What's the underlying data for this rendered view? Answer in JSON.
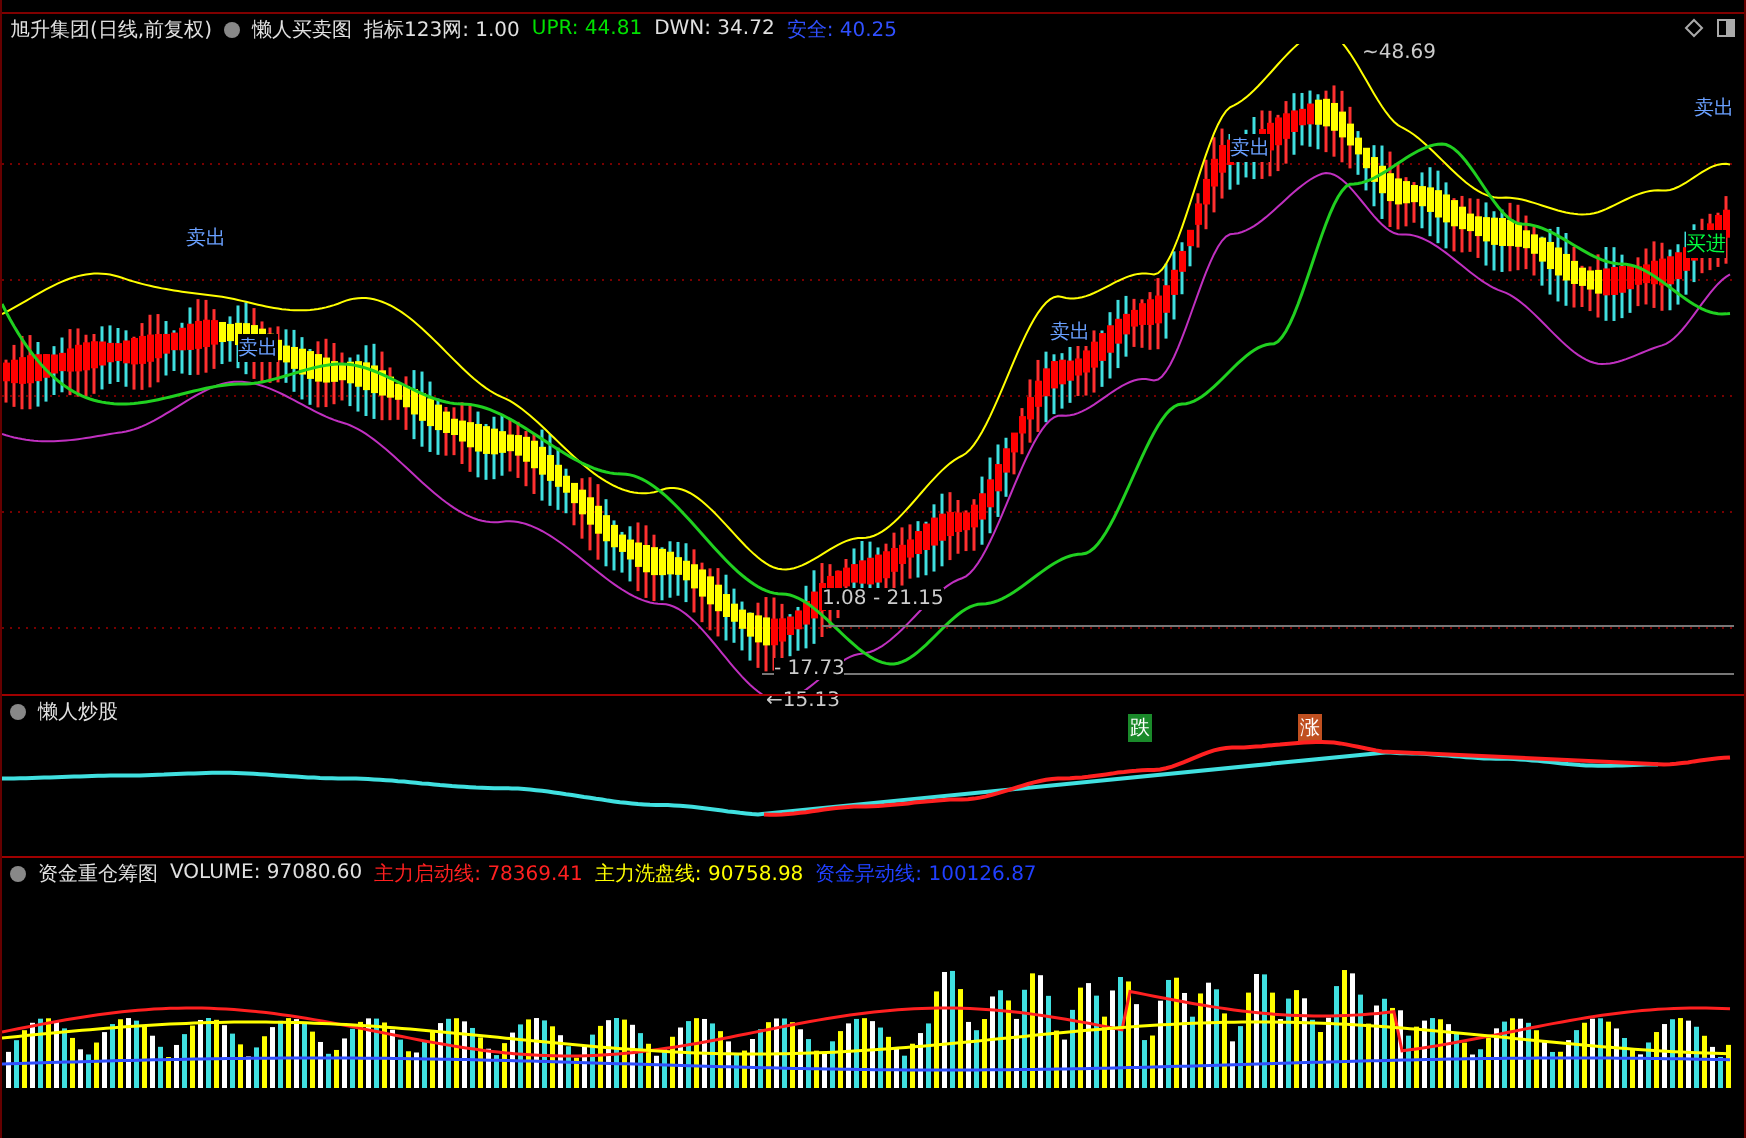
{
  "header": {
    "stock": "旭升集团(日线,前复权)",
    "indicator": "懒人买卖图",
    "params": [
      {
        "label": "指标123网: 1.00",
        "color": "#e0e0e0"
      },
      {
        "label": "UPR: 44.81",
        "color": "#00e000"
      },
      {
        "label": "DWN: 34.72",
        "color": "#e0e0e0"
      },
      {
        "label": "安全: 40.25",
        "color": "#3050ff"
      }
    ]
  },
  "price_labels": [
    "~48.69",
    "1.08 - 21.15",
    "- 17.73",
    "←15.13"
  ],
  "signals": [
    {
      "text": "卖出",
      "kind": "sell"
    },
    {
      "text": "卖出",
      "kind": "sell"
    },
    {
      "text": "卖出",
      "kind": "sell"
    },
    {
      "text": "卖出",
      "kind": "sell"
    },
    {
      "text": "卖出",
      "kind": "sell"
    },
    {
      "text": "买进",
      "kind": "buy"
    },
    {
      "text": "跌",
      "kind": "down"
    },
    {
      "text": "涨",
      "kind": "up"
    }
  ],
  "panel2": {
    "title": "懒人炒股"
  },
  "panel3": {
    "title": "资金重仓筹图",
    "params": [
      {
        "label": "VOLUME: 97080.60",
        "color": "#e0e0e0"
      },
      {
        "label": "主力启动线: 78369.41",
        "color": "#ff2020"
      },
      {
        "label": "主力洗盘线: 90758.98",
        "color": "#ffff00"
      },
      {
        "label": "资金异动线: 100126.87",
        "color": "#2040ff"
      }
    ]
  }
}
